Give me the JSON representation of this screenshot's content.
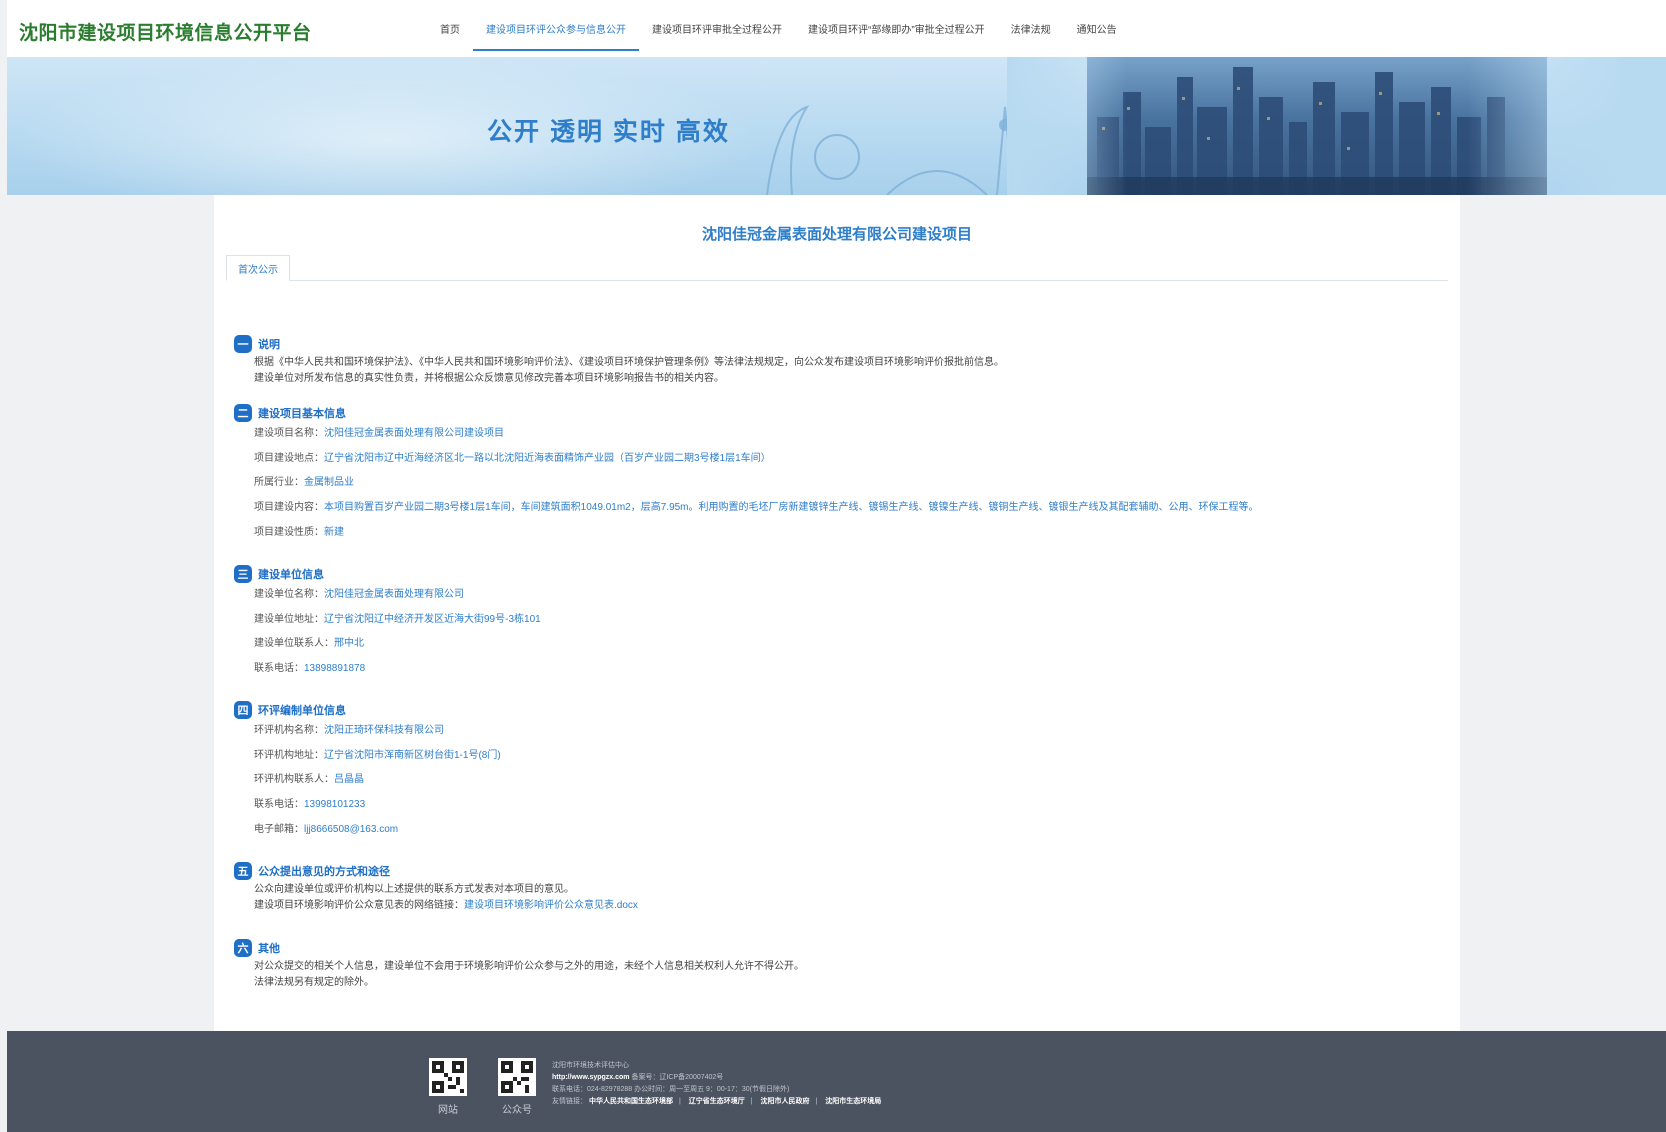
{
  "header": {
    "logo": "沈阳市建设项目环境信息公开平台",
    "nav": [
      {
        "label": "首页"
      },
      {
        "label": "建设项目环评公众参与信息公开"
      },
      {
        "label": "建设项目环评审批全过程公开"
      },
      {
        "label": "建设项目环评“部缘即办”审批全过程公开"
      },
      {
        "label": "法律法规"
      },
      {
        "label": "通知公告"
      }
    ]
  },
  "banner": {
    "slogan": "公开 透明 实时 高效"
  },
  "content": {
    "title": "沈阳佳冠金属表面处理有限公司建设项目",
    "tab": "首次公示",
    "sections": [
      {
        "num": "一",
        "title": "说明",
        "paras": [
          "根据《中华人民共和国环境保护法》、《中华人民共和国环境影响评价法》、《建设项目环境保护管理条例》等法律法规规定，向公众发布建设项目环境影响评价报批前信息。",
          "建设单位对所发布信息的真实性负责，并将根据公众反馈意见修改完善本项目环境影响报告书的相关内容。"
        ]
      },
      {
        "num": "二",
        "title": "建设项目基本信息",
        "rows": [
          {
            "k": "建设项目名称：",
            "v": "沈阳佳冠金属表面处理有限公司建设项目"
          },
          {
            "k": "项目建设地点：",
            "v": "辽宁省沈阳市辽中近海经济区北一路以北沈阳近海表面精饰产业园（百岁产业园二期3号楼1层1车间）"
          },
          {
            "k": "所属行业：",
            "v": "金属制品业"
          },
          {
            "k": "项目建设内容：",
            "v": "本项目购置百岁产业园二期3号楼1层1车间，车间建筑面积1049.01m2，层高7.95m。利用购置的毛坯厂房新建镀锌生产线、镀锡生产线、镀镍生产线、镀铜生产线、镀银生产线及其配套辅助、公用、环保工程等。"
          },
          {
            "k": "项目建设性质：",
            "v": "新建"
          }
        ]
      },
      {
        "num": "三",
        "title": "建设单位信息",
        "rows": [
          {
            "k": "建设单位名称：",
            "v": "沈阳佳冠金属表面处理有限公司"
          },
          {
            "k": "建设单位地址：",
            "v": "辽宁省沈阳辽中经济开发区近海大街99号-3栋101"
          },
          {
            "k": "建设单位联系人：",
            "v": "邢中北"
          },
          {
            "k": "联系电话：",
            "v": "13898891878"
          }
        ]
      },
      {
        "num": "四",
        "title": "环评编制单位信息",
        "rows": [
          {
            "k": "环评机构名称：",
            "v": "沈阳正琦环保科技有限公司"
          },
          {
            "k": "环评机构地址：",
            "v": "辽宁省沈阳市浑南新区树台街1-1号(8门)"
          },
          {
            "k": "环评机构联系人：",
            "v": "吕晶晶"
          },
          {
            "k": "联系电话：",
            "v": "13998101233"
          },
          {
            "k": "电子邮箱：",
            "v": "ljj8666508@163.com"
          }
        ]
      },
      {
        "num": "五",
        "title": "公众提出意见的方式和途径",
        "paras": [
          "公众向建设单位或评价机构以上述提供的联系方式发表对本项目的意见。"
        ],
        "link_prefix": "建设项目环境影响评价公众意见表的网络链接：",
        "link": "建设项目环境影响评价公众意见表.docx"
      },
      {
        "num": "六",
        "title": "其他",
        "paras": [
          "对公众提交的相关个人信息，建设单位不会用于环境影响评价公众参与之外的用途，未经个人信息相关权利人允许不得公开。",
          "法律法规另有规定的除外。"
        ]
      }
    ]
  },
  "footer": {
    "qr1_caption": "网站",
    "qr2_caption": "公众号",
    "org": "沈阳市环境技术评估中心",
    "url": "http://www.sypgzx.com",
    "icp": "备案号：辽ICP备20007402号",
    "contact": "联系电话：024-82978288 办公时间：周一至周五 9：00-17：30(节假日除外)",
    "links_label": "友情链接：",
    "links": [
      "中华人民共和国生态环境部",
      "辽宁省生态环境厅",
      "沈阳市人民政府",
      "沈阳市生态环境局"
    ]
  }
}
